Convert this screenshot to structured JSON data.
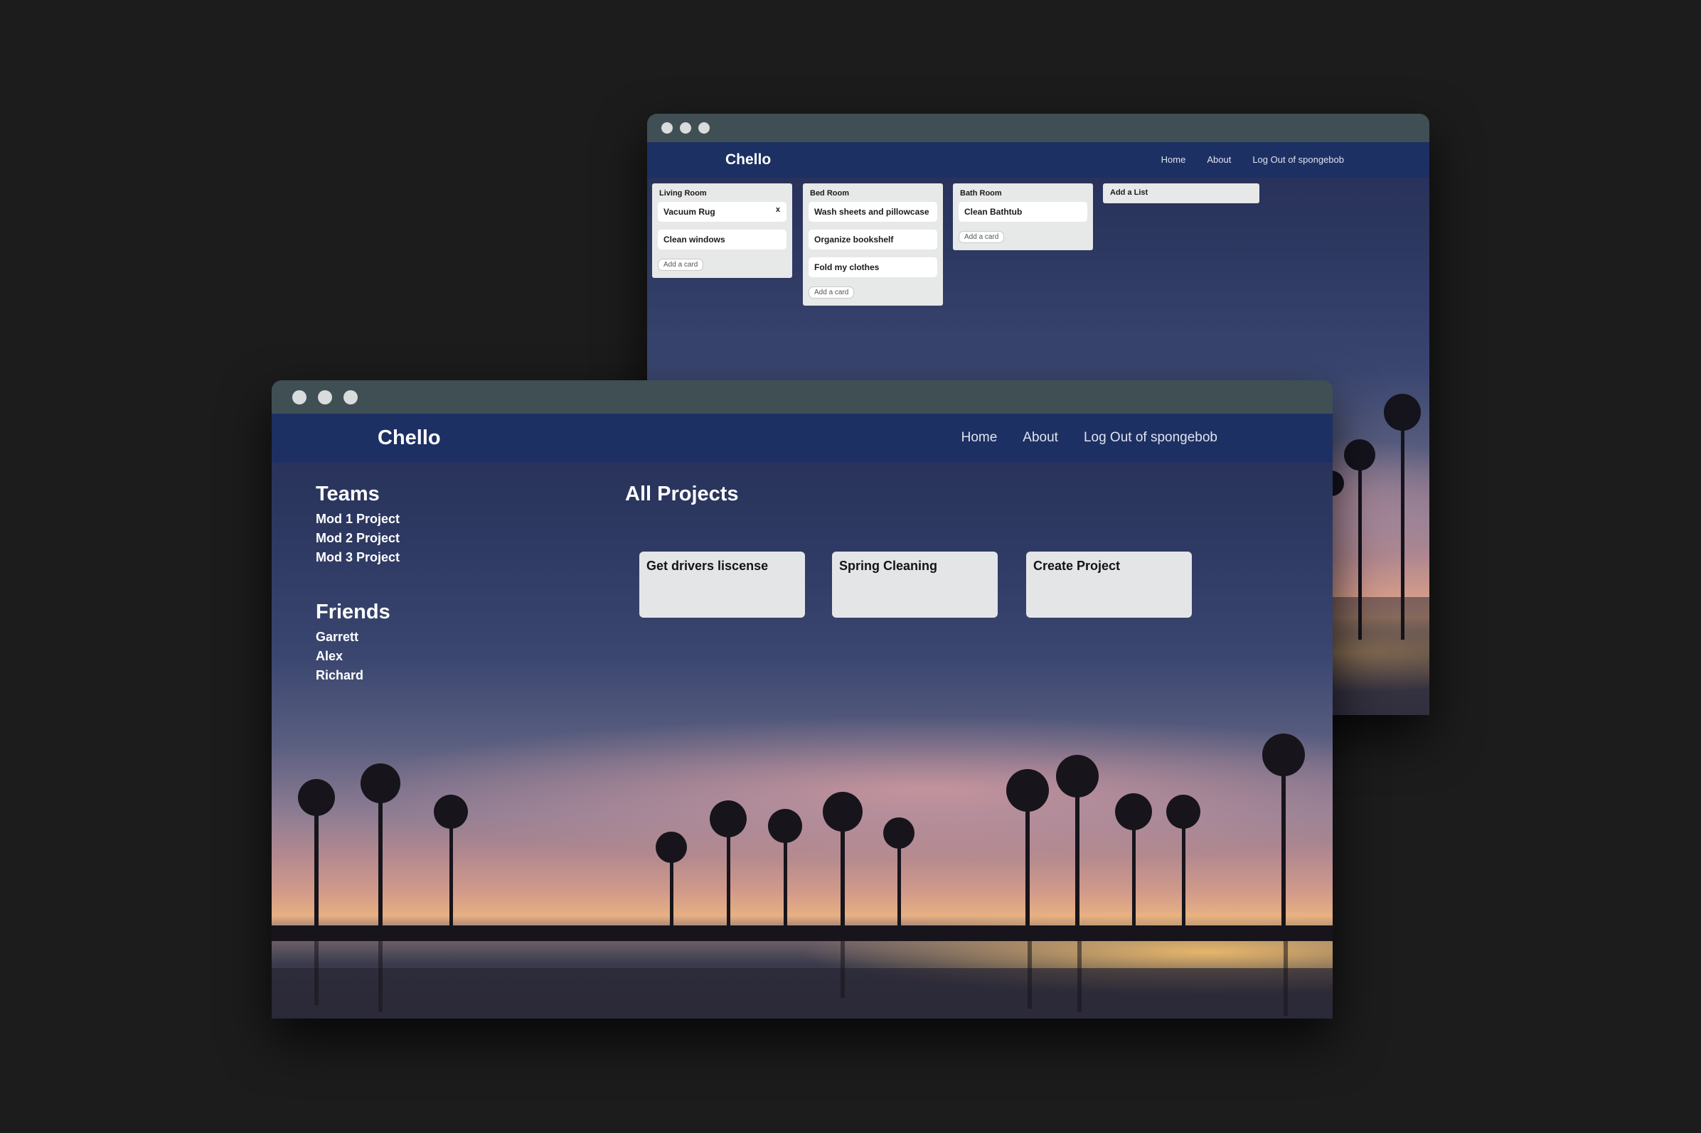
{
  "colors": {
    "page_background": "#1c1c1c",
    "titlebar": "#3f4f54",
    "navbar": "#1d3064",
    "card": "#ffffff",
    "list": "#e7e8e8",
    "project_card": "#e4e5e6"
  },
  "board_window": {
    "navbar": {
      "brand": "Chello",
      "links": [
        "Home",
        "About",
        "Log Out of spongebob"
      ]
    },
    "lists": [
      {
        "title": "Living Room",
        "cards": [
          "Vacuum Rug",
          "Clean windows"
        ],
        "delete_glyph": "x",
        "add_card_label": "Add a card"
      },
      {
        "title": "Bed Room",
        "cards": [
          "Wash sheets and pillowcase",
          "Organize bookshelf",
          "Fold my clothes"
        ],
        "add_card_label": "Add a card"
      },
      {
        "title": "Bath Room",
        "cards": [
          "Clean Bathtub"
        ],
        "add_card_label": "Add a card"
      }
    ],
    "add_list_label": "Add a List"
  },
  "home_window": {
    "navbar": {
      "brand": "Chello",
      "links": [
        "Home",
        "About",
        "Log Out of spongebob"
      ]
    },
    "teams": {
      "heading": "Teams",
      "items": [
        "Mod 1 Project",
        "Mod 2 Project",
        "Mod 3 Project"
      ]
    },
    "friends": {
      "heading": "Friends",
      "items": [
        "Garrett",
        "Alex",
        "Richard"
      ]
    },
    "projects": {
      "heading": "All Projects",
      "items": [
        "Get drivers liscense",
        "Spring Cleaning",
        "Create Project"
      ]
    }
  },
  "icons": [
    "window-close-dot-icon",
    "window-minimize-dot-icon",
    "window-maximize-dot-icon",
    "delete-card-icon"
  ]
}
